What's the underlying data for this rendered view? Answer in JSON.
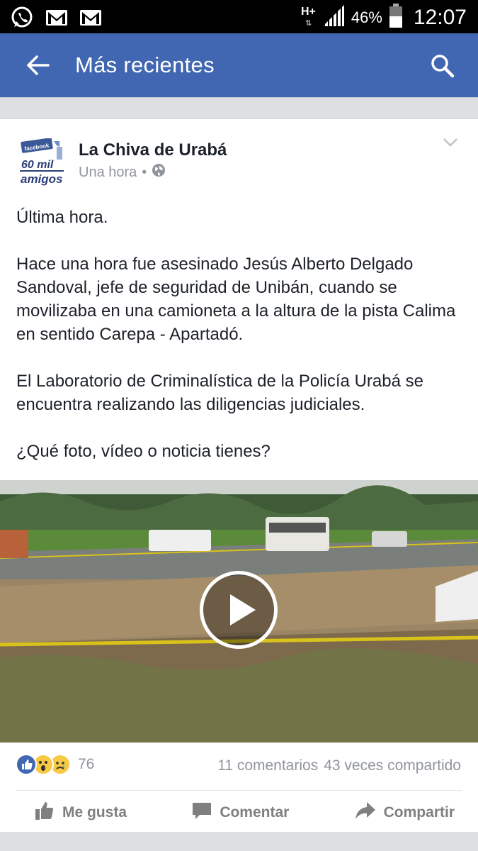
{
  "status_bar": {
    "network": "H+",
    "battery": "46%",
    "time": "12:07",
    "icons": [
      "whatsapp-icon",
      "gmail-icon",
      "gmail-icon",
      "signal-icon",
      "battery-icon"
    ]
  },
  "app_bar": {
    "title": "Más recientes",
    "color": "#4267b2"
  },
  "post": {
    "page_name": "La Chiva de Urabá",
    "time": "Una hora",
    "separator": "•",
    "avatar": {
      "badge": "facebook",
      "line1": "60 mil",
      "line2": "amigos"
    },
    "text": [
      "Última hora.",
      "Hace una hora fue asesinado Jesús Alberto Delgado Sandoval, jefe de seguridad de Unibán, cuando se movilizaba en una camioneta a la altura de  la pista Calima en sentido Carepa - Apartadó.",
      "El Laboratorio de Criminalística de la Policía Urabá se encuentra realizando las diligencias judiciales.",
      "¿Qué foto, vídeo o noticia tienes?"
    ],
    "reactions": {
      "types": [
        "like",
        "wow",
        "sad"
      ],
      "count": "76"
    },
    "comments": "11 comentarios",
    "shares": "43 veces compartido",
    "actions": {
      "like": "Me gusta",
      "comment": "Comentar",
      "share": "Compartir"
    }
  }
}
